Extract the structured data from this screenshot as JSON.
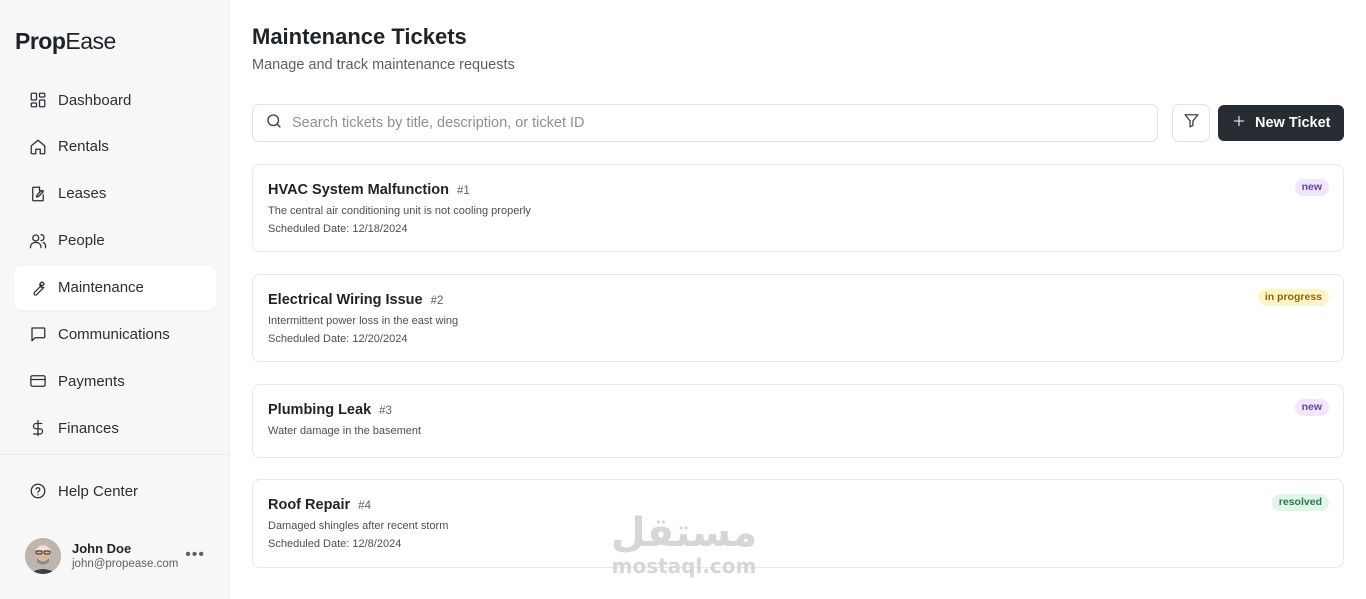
{
  "brand": {
    "name_bold": "Prop",
    "name_light": "Ease"
  },
  "sidebar": {
    "items": [
      {
        "label": "Dashboard",
        "icon": "dashboard-icon"
      },
      {
        "label": "Rentals",
        "icon": "home-icon"
      },
      {
        "label": "Leases",
        "icon": "document-edit-icon"
      },
      {
        "label": "People",
        "icon": "users-icon"
      },
      {
        "label": "Maintenance",
        "icon": "wrench-icon",
        "active": true
      },
      {
        "label": "Communications",
        "icon": "message-icon"
      },
      {
        "label": "Payments",
        "icon": "credit-card-icon"
      },
      {
        "label": "Finances",
        "icon": "dollar-icon"
      }
    ],
    "help": {
      "label": "Help Center",
      "icon": "help-circle-icon"
    },
    "user": {
      "name": "John Doe",
      "email": "john@propease.com"
    }
  },
  "header": {
    "title": "Maintenance Tickets",
    "subtitle": "Manage and track maintenance requests"
  },
  "search": {
    "placeholder": "Search tickets by title, description, or ticket ID",
    "value": ""
  },
  "toolbar": {
    "new_ticket_label": "New Ticket"
  },
  "tickets": [
    {
      "title": "HVAC System Malfunction",
      "id": "#1",
      "description": "The central air conditioning unit is not cooling properly",
      "date": "Scheduled Date: 12/18/2024",
      "status": "new"
    },
    {
      "title": "Electrical Wiring Issue",
      "id": "#2",
      "description": "Intermittent power loss in the east wing",
      "date": "Scheduled Date: 12/20/2024",
      "status": "in progress"
    },
    {
      "title": "Plumbing Leak",
      "id": "#3",
      "description": "Water damage in the basement",
      "date": "",
      "status": "new"
    },
    {
      "title": "Roof Repair",
      "id": "#4",
      "description": "Damaged shingles after recent storm",
      "date": "Scheduled Date: 12/8/2024",
      "status": "resolved"
    }
  ],
  "colors": {
    "primary_button": "#262c31",
    "badge_new": "#efe8fb",
    "badge_in_progress": "#fdf5c9",
    "badge_resolved": "#e1f5e8"
  },
  "watermark": {
    "arabic": "مستقل",
    "latin": "mostaql.com"
  }
}
